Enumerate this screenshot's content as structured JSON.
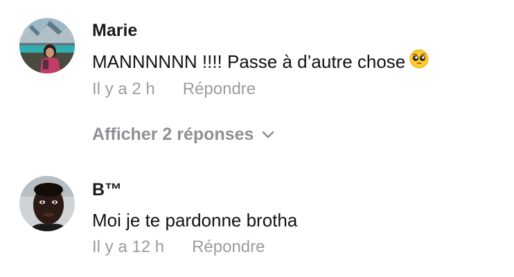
{
  "comments": [
    {
      "username": "Marie",
      "text": "MANNNNNN !!!! Passe à d’autre chose",
      "emoji_icon": "pleading-face-icon",
      "time": "Il y a 2 h",
      "reply_label": "Répondre"
    },
    {
      "username": "B™",
      "text": "Moi je te pardonne brotha",
      "time": "Il y a 12 h",
      "reply_label": "Répondre"
    }
  ],
  "replies_toggle": {
    "label": "Afficher 2 réponses",
    "icon": "chevron-down-icon"
  },
  "colors": {
    "text": "#111111",
    "muted": "#9a9ca2"
  }
}
